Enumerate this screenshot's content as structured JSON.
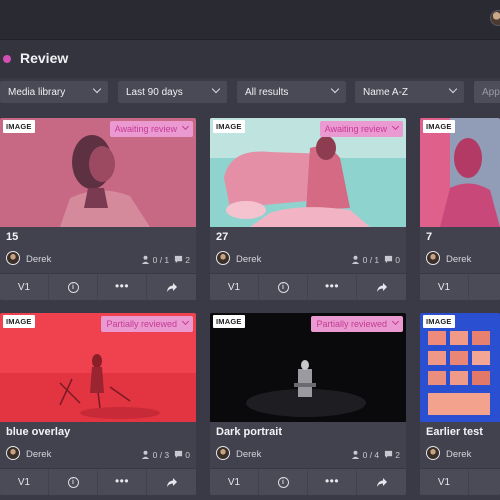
{
  "header": {
    "title": "Review"
  },
  "filters": [
    {
      "label": "Media library"
    },
    {
      "label": "Last 90 days"
    },
    {
      "label": "All results"
    },
    {
      "label": "Name A-Z"
    },
    {
      "label": "App"
    }
  ],
  "colors": {
    "accent": "#d24fb4",
    "status_bg": "#ea9ad0",
    "status_text": "#c53a97"
  },
  "cards": [
    {
      "type": "IMAGE",
      "status": "Awaiting review",
      "name": "15",
      "owner": "Derek",
      "reviewers": "0 / 1",
      "comments": "2",
      "version": "V1"
    },
    {
      "type": "IMAGE",
      "status": "Awaiting review",
      "name": "27",
      "owner": "Derek",
      "reviewers": "0 / 1",
      "comments": "0",
      "version": "V1"
    },
    {
      "type": "IMAGE",
      "status": "",
      "name": "7",
      "owner": "Derek",
      "reviewers": "",
      "comments": "",
      "version": "V1"
    },
    {
      "type": "IMAGE",
      "status": "Partially reviewed",
      "name": "blue overlay",
      "owner": "Derek",
      "reviewers": "0 / 3",
      "comments": "0",
      "version": "V1"
    },
    {
      "type": "IMAGE",
      "status": "Partially reviewed",
      "name": "Dark portrait",
      "owner": "Derek",
      "reviewers": "0 / 4",
      "comments": "2",
      "version": "V1"
    },
    {
      "type": "IMAGE",
      "status": "",
      "name": "Earlier test",
      "owner": "Derek",
      "reviewers": "",
      "comments": "",
      "version": "V1"
    }
  ]
}
